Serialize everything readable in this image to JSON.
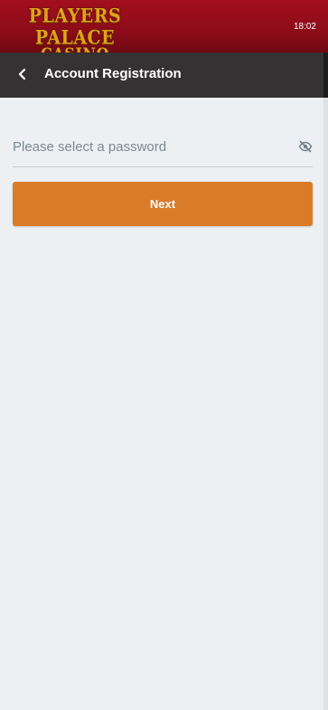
{
  "status_bar": {
    "time": "18:02"
  },
  "brand": {
    "logo_line1": "PLAYERS PALACE",
    "logo_line2": "CASINO",
    "logo_color": "#e0a21a",
    "bar_color": "#a30f1f"
  },
  "header": {
    "title": "Account Registration",
    "back_icon": "chevron-left-icon",
    "bar_color": "#353233"
  },
  "form": {
    "password": {
      "value": "",
      "placeholder": "Please select a password",
      "toggle_icon": "eye-off-icon"
    },
    "next_label": "Next",
    "next_color": "#d97b29"
  }
}
